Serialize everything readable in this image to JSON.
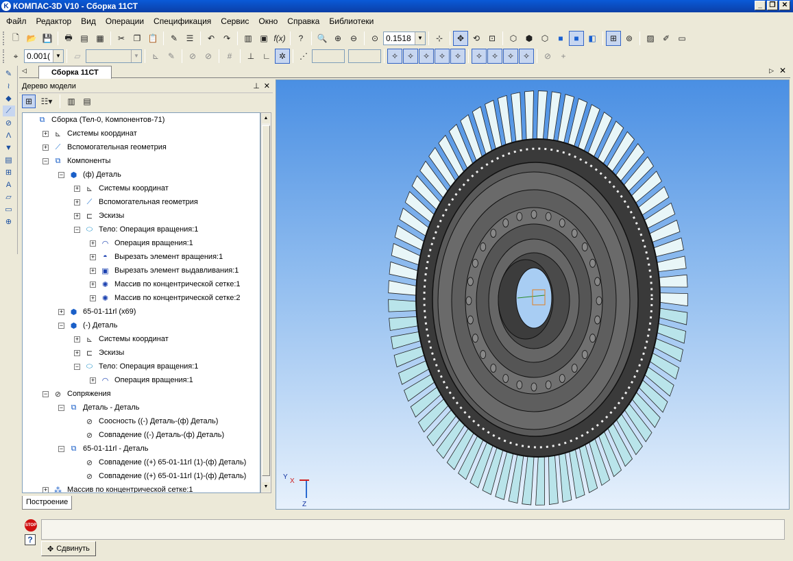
{
  "window": {
    "title": "КОМПАС-3D V10 - Сборка 11СТ",
    "buttons": [
      "_",
      "❐",
      "✕"
    ]
  },
  "menu": [
    "Файл",
    "Редактор",
    "Вид",
    "Операции",
    "Спецификация",
    "Сервис",
    "Окно",
    "Справка",
    "Библиотеки"
  ],
  "toolbar": {
    "zoom_value": "0.1518",
    "step_value": "0.001("
  },
  "doc_tab": "Сборка 11СТ",
  "tree_panel": {
    "title": "Дерево модели",
    "bottom_tab": "Построение"
  },
  "tree": [
    {
      "label": "Сборка (Тел-0, Компонентов-71)",
      "level": 0,
      "exp": "",
      "icon": "assembly-icon"
    },
    {
      "label": "Системы координат",
      "level": 1,
      "exp": "+",
      "icon": "coordinate-system-icon"
    },
    {
      "label": "Вспомогательная геометрия",
      "level": 1,
      "exp": "+",
      "icon": "auxiliary-geometry-icon"
    },
    {
      "label": "Компоненты",
      "level": 1,
      "exp": "−",
      "icon": "components-icon"
    },
    {
      "label": "(ф) Деталь",
      "level": 2,
      "exp": "−",
      "icon": "part-icon"
    },
    {
      "label": "Системы координат",
      "level": 3,
      "exp": "+",
      "icon": "coordinate-system-icon"
    },
    {
      "label": "Вспомогательная геометрия",
      "level": 3,
      "exp": "+",
      "icon": "auxiliary-geometry-icon"
    },
    {
      "label": "Эскизы",
      "level": 3,
      "exp": "+",
      "icon": "sketches-icon"
    },
    {
      "label": "Тело:  Операция вращения:1",
      "level": 3,
      "exp": "−",
      "icon": "body-icon"
    },
    {
      "label": "Операция вращения:1",
      "level": 4,
      "exp": "+",
      "icon": "rotation-operation-icon"
    },
    {
      "label": "Вырезать элемент вращения:1",
      "level": 4,
      "exp": "+",
      "icon": "cut-rotation-icon"
    },
    {
      "label": "Вырезать элемент выдавливания:1",
      "level": 4,
      "exp": "+",
      "icon": "cut-extrusion-icon"
    },
    {
      "label": "Массив по концентрической сетке:1",
      "level": 4,
      "exp": "+",
      "icon": "circular-array-icon"
    },
    {
      "label": "Массив по концентрической сетке:2",
      "level": 4,
      "exp": "+",
      "icon": "circular-array-icon"
    },
    {
      "label": "65-01-11rl (x69)",
      "level": 2,
      "exp": "+",
      "icon": "part-icon"
    },
    {
      "label": "(-) Деталь",
      "level": 2,
      "exp": "−",
      "icon": "part-icon"
    },
    {
      "label": "Системы координат",
      "level": 3,
      "exp": "+",
      "icon": "coordinate-system-icon"
    },
    {
      "label": "Эскизы",
      "level": 3,
      "exp": "+",
      "icon": "sketches-icon"
    },
    {
      "label": "Тело:  Операция вращения:1",
      "level": 3,
      "exp": "−",
      "icon": "body-icon"
    },
    {
      "label": "Операция вращения:1",
      "level": 4,
      "exp": "+",
      "icon": "rotation-operation-icon"
    },
    {
      "label": "Сопряжения",
      "level": 1,
      "exp": "−",
      "icon": "mates-icon"
    },
    {
      "label": "Деталь - Деталь",
      "level": 2,
      "exp": "−",
      "icon": "mate-group-icon"
    },
    {
      "label": "Соосность ((-) Деталь-(ф) Деталь)",
      "level": 3,
      "exp": "",
      "icon": "mate-icon"
    },
    {
      "label": "Совпадение ((-) Деталь-(ф) Деталь)",
      "level": 3,
      "exp": "",
      "icon": "mate-icon"
    },
    {
      "label": "65-01-11rl - Деталь",
      "level": 2,
      "exp": "−",
      "icon": "mate-group-icon"
    },
    {
      "label": "Совпадение ((+) 65-01-11rl (1)-(ф) Деталь)",
      "level": 3,
      "exp": "",
      "icon": "mate-icon"
    },
    {
      "label": "Совпадение ((+) 65-01-11rl (1)-(ф) Деталь)",
      "level": 3,
      "exp": "",
      "icon": "mate-icon"
    },
    {
      "label": "Массив по концентрической сетке:1",
      "level": 1,
      "exp": "+",
      "icon": "array-component-icon"
    }
  ],
  "viewport": {
    "axis_labels": {
      "x": "X",
      "y": "Y",
      "z": "Z"
    }
  },
  "status": {
    "stop_label": "STOP",
    "help_label": "?",
    "move_button": "Сдвинуть"
  }
}
